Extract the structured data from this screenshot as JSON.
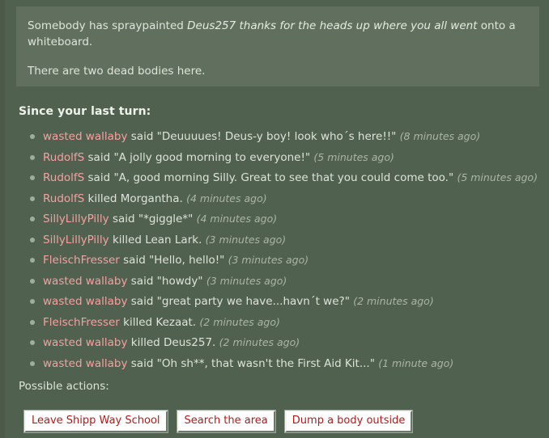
{
  "description": {
    "line1_prefix": "Somebody has spraypainted ",
    "line1_spray": "Deus257 thanks for the heads up where you all went",
    "line1_suffix": " onto a whiteboard.",
    "line2": "There are two dead bodies here."
  },
  "since_last_turn": {
    "heading": "Since your last turn:",
    "events": [
      {
        "user": "wasted wallaby",
        "text": " said \"Deuuuues! Deus-y boy! look who´s here!!\" ",
        "time": "(8 minutes ago)"
      },
      {
        "user": "RudolfS",
        "text": " said \"A jolly good morning to everyone!\" ",
        "time": "(5 minutes ago)"
      },
      {
        "user": "RudolfS",
        "text": " said \"A, good morning Silly. Great to see that you could come too.\" ",
        "time": "(5 minutes ago)"
      },
      {
        "user": "RudolfS",
        "text": " killed Morgantha. ",
        "time": "(4 minutes ago)"
      },
      {
        "user": "SillyLillyPilly",
        "text": " said \"*giggle*\" ",
        "time": "(4 minutes ago)"
      },
      {
        "user": "SillyLillyPilly",
        "text": " killed Lean Lark. ",
        "time": "(3 minutes ago)"
      },
      {
        "user": "FleischFresser",
        "text": " said \"Hello, hello!\" ",
        "time": "(3 minutes ago)"
      },
      {
        "user": "wasted wallaby",
        "text": " said \"howdy\" ",
        "time": "(3 minutes ago)"
      },
      {
        "user": "wasted wallaby",
        "text": " said \"great party we have...havn´t we?\" ",
        "time": "(2 minutes ago)"
      },
      {
        "user": "FleischFresser",
        "text": " killed Kezaat. ",
        "time": "(2 minutes ago)"
      },
      {
        "user": "wasted wallaby",
        "text": " killed Deus257. ",
        "time": "(2 minutes ago)"
      },
      {
        "user": "wasted wallaby",
        "text": " said \"Oh sh**, that wasn't the First Aid Kit...\" ",
        "time": "(1 minute ago)"
      }
    ]
  },
  "actions": {
    "heading": "Possible actions:",
    "buttons": [
      {
        "label": "Leave Shipp Way School"
      },
      {
        "label": "Search the area"
      },
      {
        "label": "Dump a body outside"
      }
    ]
  },
  "colors": {
    "background": "#51614f",
    "gutter": "#4b5a49",
    "description_box": "#61705e",
    "username": "#f5a0a0",
    "body_text": "#dde3d9",
    "timestamp": "#aab6a5",
    "button_face": "#ffffff",
    "button_text": "#b41a1a"
  }
}
